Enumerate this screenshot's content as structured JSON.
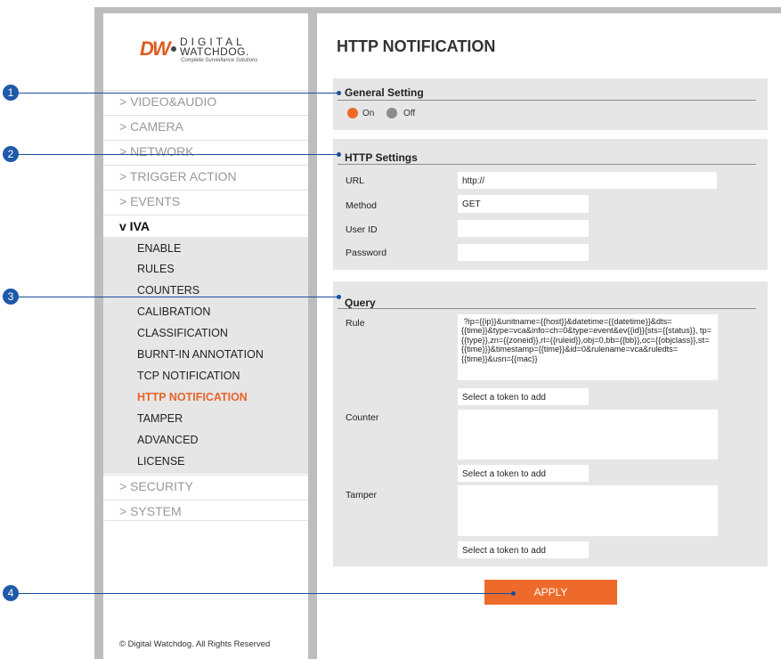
{
  "logo": {
    "brand": "DW",
    "line1": "DIGITAL",
    "line2": "WATCHDOG.",
    "tagline": "Complete Surveillance Solutions"
  },
  "menu": [
    {
      "label": "> VIDEO&AUDIO"
    },
    {
      "label": "> CAMERA"
    },
    {
      "label": "> NETWORK"
    },
    {
      "label": "> TRIGGER ACTION"
    },
    {
      "label": "> EVENTS"
    },
    {
      "label": "v IVA"
    },
    {
      "label": "> SECURITY"
    },
    {
      "label": "> SYSTEM"
    }
  ],
  "iva_submenu": [
    "ENABLE",
    "RULES",
    "COUNTERS",
    "CALIBRATION",
    "CLASSIFICATION",
    "BURNT-IN ANNOTATION",
    "TCP NOTIFICATION",
    "HTTP NOTIFICATION",
    "TAMPER",
    "ADVANCED",
    "LICENSE"
  ],
  "active_submenu": "HTTP NOTIFICATION",
  "footer": "© Digital Watchdog. All Rights Reserved",
  "page_title": "HTTP NOTIFICATION",
  "general": {
    "title": "General Setting",
    "on_label": "On",
    "off_label": "Off",
    "selected": "On"
  },
  "http": {
    "title": "HTTP Settings",
    "url_label": "URL",
    "url_value": "http://",
    "method_label": "Method",
    "method_value": "GET",
    "userid_label": "User ID",
    "userid_value": "",
    "password_label": "Password",
    "password_value": ""
  },
  "query": {
    "title": "Query",
    "rule_label": "Rule",
    "rule_value": " ?ip={{ip}}&unitname={{host}}&datetime={{datetime}}&dts={{time}}&type=vca&info=ch=0&type=event&ev{{id}}{sts={{status}}, tp={{type}},zn={{zoneid}},rl={{ruleid}},obj=0,bb={{bb}},oc={{objclass}},st={{time}}}&timestamp={{time}}&id=0&rulename=vca&ruledts={{time}}&usn={{mac}}",
    "counter_label": "Counter",
    "counter_value": "",
    "tamper_label": "Tamper",
    "tamper_value": "",
    "token_placeholder": "Select a token to add"
  },
  "apply_label": "APPLY",
  "callouts": [
    "1",
    "2",
    "3",
    "4"
  ],
  "colors": {
    "accent": "#ee6a2a",
    "callout": "#1f5aa8"
  }
}
